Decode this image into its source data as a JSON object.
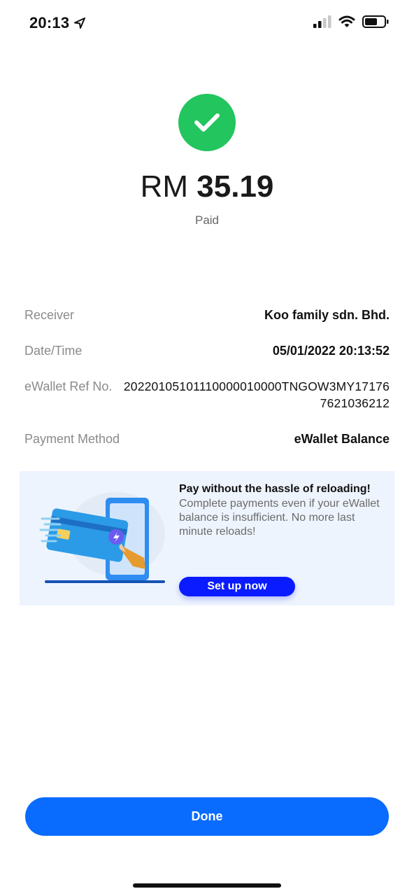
{
  "status_bar": {
    "time": "20:13",
    "location_icon": "location-arrow-icon",
    "signal_icon": "cellular-signal-icon",
    "wifi_icon": "wifi-icon",
    "battery_icon": "battery-icon"
  },
  "payment": {
    "icon": "check-icon",
    "currency": "RM",
    "amount": "35.19",
    "status": "Paid",
    "success_color": "#22c55e"
  },
  "details": [
    {
      "label": "Receiver",
      "value": "Koo family sdn. Bhd."
    },
    {
      "label": "Date/Time",
      "value": "05/01/2022 20:13:52"
    },
    {
      "label": "eWallet Ref No.",
      "value": "20220105101110000010000TNGOW3MY171767621036212"
    },
    {
      "label": "Payment Method",
      "value": "eWallet Balance"
    }
  ],
  "promo": {
    "title": "Pay without the hassle of reloading!",
    "description": "Complete payments even if your eWallet balance is insufficient. No more last minute reloads!",
    "button_label": "Set up now",
    "background": "#eef4fd",
    "button_color": "#0a1bff"
  },
  "actions": {
    "done_label": "Done",
    "done_color": "#0a6cff"
  }
}
